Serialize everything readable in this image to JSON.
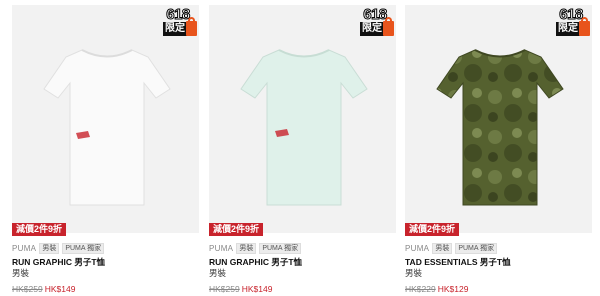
{
  "products": [
    {
      "badge": {
        "number": "618",
        "label": "限定"
      },
      "promo": "減價2件9折",
      "brand": "PUMA",
      "chips": [
        "男裝",
        "PUMA 獨家"
      ],
      "title": "RUN GRAPHIC 男子T恤",
      "gender": "男裝",
      "price_old": "HK$259",
      "price_new": "HK$149",
      "shirt_color": "#fafafa",
      "accent_color": "#c8232c"
    },
    {
      "badge": {
        "number": "618",
        "label": "限定"
      },
      "promo": "減價2件9折",
      "brand": "PUMA",
      "chips": [
        "男裝",
        "PUMA 獨家"
      ],
      "title": "RUN GRAPHIC 男子T恤",
      "gender": "男裝",
      "price_old": "HK$259",
      "price_new": "HK$149",
      "shirt_color": "#dff1ea",
      "accent_color": "#c8232c"
    },
    {
      "badge": {
        "number": "618",
        "label": "限定"
      },
      "promo": "減價2件9折",
      "brand": "PUMA",
      "chips": [
        "男裝",
        "PUMA 獨家"
      ],
      "title": "TAD ESSENTIALS 男子T恤",
      "gender": "男裝",
      "price_old": "HK$229",
      "price_new": "HK$129",
      "shirt_color": "#55612f",
      "accent_color": "#c8232c"
    }
  ]
}
